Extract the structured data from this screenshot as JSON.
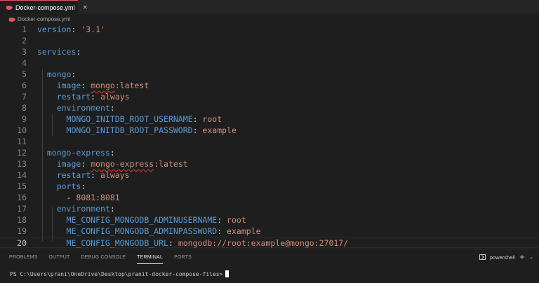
{
  "tab": {
    "label": "Docker-compose.yml",
    "close": "×"
  },
  "breadcrumb": {
    "label": "Docker-compose.yml"
  },
  "editor": {
    "current_line": 20,
    "lines": [
      {
        "n": "1",
        "parts": [
          [
            "k",
            "version"
          ],
          [
            "p",
            ": "
          ],
          [
            "s",
            "'3.1'"
          ]
        ]
      },
      {
        "n": "2",
        "parts": []
      },
      {
        "n": "3",
        "parts": [
          [
            "k",
            "services"
          ],
          [
            "p",
            ":"
          ]
        ]
      },
      {
        "n": "4",
        "parts": []
      },
      {
        "n": "5",
        "parts": [
          [
            "p",
            "  "
          ],
          [
            "k",
            "mongo"
          ],
          [
            "p",
            ":"
          ]
        ]
      },
      {
        "n": "6",
        "parts": [
          [
            "p",
            "    "
          ],
          [
            "k",
            "image"
          ],
          [
            "p",
            ": "
          ],
          [
            "su",
            "mongo"
          ],
          [
            "s",
            ":latest"
          ]
        ]
      },
      {
        "n": "7",
        "parts": [
          [
            "p",
            "    "
          ],
          [
            "k",
            "restart"
          ],
          [
            "p",
            ": "
          ],
          [
            "s",
            "always"
          ]
        ]
      },
      {
        "n": "8",
        "parts": [
          [
            "p",
            "    "
          ],
          [
            "k",
            "environment"
          ],
          [
            "p",
            ":"
          ]
        ]
      },
      {
        "n": "9",
        "parts": [
          [
            "p",
            "      "
          ],
          [
            "k",
            "MONGO_INITDB_ROOT_USERNAME"
          ],
          [
            "p",
            ": "
          ],
          [
            "s",
            "root"
          ]
        ]
      },
      {
        "n": "10",
        "parts": [
          [
            "p",
            "      "
          ],
          [
            "k",
            "MONGO_INITDB_ROOT_PASSWORD"
          ],
          [
            "p",
            ": "
          ],
          [
            "s",
            "example"
          ]
        ]
      },
      {
        "n": "11",
        "parts": []
      },
      {
        "n": "12",
        "parts": [
          [
            "p",
            "  "
          ],
          [
            "k",
            "mongo-express"
          ],
          [
            "p",
            ":"
          ]
        ]
      },
      {
        "n": "13",
        "parts": [
          [
            "p",
            "    "
          ],
          [
            "k",
            "image"
          ],
          [
            "p",
            ": "
          ],
          [
            "su",
            "mongo-express"
          ],
          [
            "s",
            ":latest"
          ]
        ]
      },
      {
        "n": "14",
        "parts": [
          [
            "p",
            "    "
          ],
          [
            "k",
            "restart"
          ],
          [
            "p",
            ": "
          ],
          [
            "s",
            "always"
          ]
        ]
      },
      {
        "n": "15",
        "parts": [
          [
            "p",
            "    "
          ],
          [
            "k",
            "ports"
          ],
          [
            "p",
            ":"
          ]
        ]
      },
      {
        "n": "16",
        "parts": [
          [
            "p",
            "      - "
          ],
          [
            "s",
            "8081:8081"
          ]
        ]
      },
      {
        "n": "17",
        "parts": [
          [
            "p",
            "    "
          ],
          [
            "k",
            "environment"
          ],
          [
            "p",
            ":"
          ]
        ]
      },
      {
        "n": "18",
        "parts": [
          [
            "p",
            "      "
          ],
          [
            "k",
            "ME_CONFIG_MONGODB_ADMINUSERNAME"
          ],
          [
            "p",
            ": "
          ],
          [
            "s",
            "root"
          ]
        ]
      },
      {
        "n": "19",
        "parts": [
          [
            "p",
            "      "
          ],
          [
            "k",
            "ME_CONFIG_MONGODB_ADMINPASSWORD"
          ],
          [
            "p",
            ": "
          ],
          [
            "s",
            "example"
          ]
        ]
      },
      {
        "n": "20",
        "parts": [
          [
            "p",
            "      "
          ],
          [
            "k",
            "ME_CONFIG_MONGODB_URL"
          ],
          [
            "p",
            ": "
          ],
          [
            "s",
            "mongodb://root:example@mongo:27017/"
          ]
        ]
      }
    ]
  },
  "panel": {
    "tabs": [
      "PROBLEMS",
      "OUTPUT",
      "DEBUG CONSOLE",
      "TERMINAL",
      "PORTS"
    ],
    "active_tab": "TERMINAL",
    "shell": "powershell",
    "add": "+",
    "dropdown": "⌄"
  },
  "terminal": {
    "prompt": "PS C:\\Users\\prani\\OneDrive\\Desktop\\pranit-docker-compose-files>"
  },
  "colors": {
    "tab_accent": "#e05561",
    "key": "#569cd6",
    "string": "#ce9178",
    "background": "#1e1e1e"
  }
}
